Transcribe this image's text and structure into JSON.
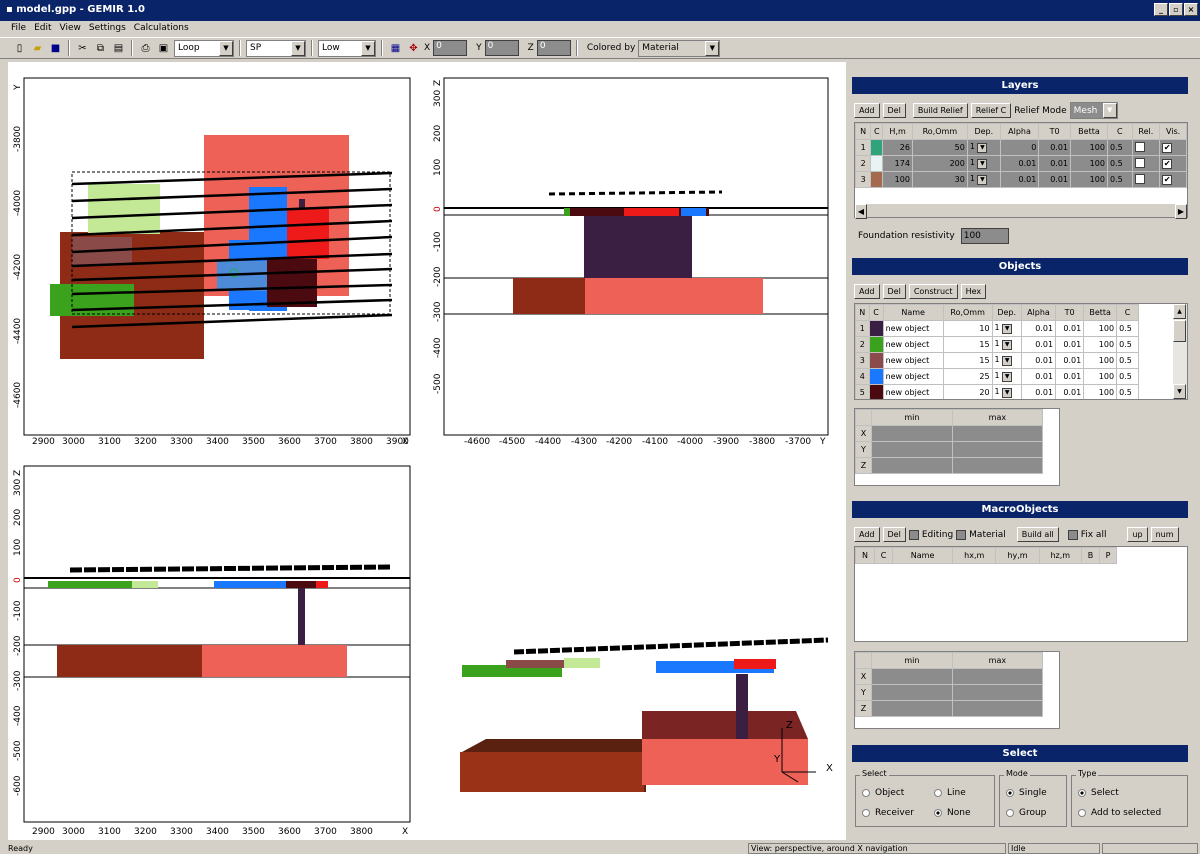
{
  "window": {
    "title": "model.gpp - GEMIR 1.0"
  },
  "menu": [
    "File",
    "Edit",
    "View",
    "Settings",
    "Calculations"
  ],
  "toolbar": {
    "mode": "Loop",
    "method": "SP",
    "quality": "Low",
    "x_label": "X",
    "x_value": "0",
    "y_label": "Y",
    "y_value": "0",
    "z_label": "Z",
    "z_value": "0",
    "colored_by_label": "Colored by",
    "colored_by": "Material"
  },
  "views": {
    "top": {
      "xticks": [
        "2900",
        "3000",
        "3100",
        "3200",
        "3300",
        "3400",
        "3500",
        "3600",
        "3700",
        "3800",
        "3900"
      ],
      "xaxis": "X",
      "yticks": [
        "-3800",
        "-4000",
        "-4200",
        "-4400",
        "-4600"
      ],
      "yaxis": "Y"
    },
    "side_y": {
      "xticks": [
        "-4600",
        "-4500",
        "-4400",
        "-4300",
        "-4200",
        "-4100",
        "-4000",
        "-3900",
        "-3800",
        "-3700"
      ],
      "xaxis": "Y",
      "yticks": [
        "300",
        "200",
        "100",
        "0",
        "-100",
        "-200",
        "-300",
        "-400",
        "-500"
      ],
      "yaxis": "Z"
    },
    "side_x": {
      "xticks": [
        "2900",
        "3000",
        "3100",
        "3200",
        "3300",
        "3400",
        "3500",
        "3600",
        "3700",
        "3800",
        "3900"
      ],
      "xaxis": "X",
      "yticks": [
        "300",
        "200",
        "100",
        "0",
        "-100",
        "-200",
        "-300",
        "-400",
        "-500",
        "-600"
      ],
      "yaxis": "Z"
    },
    "persp": {
      "x": "X",
      "y": "Y",
      "z": "Z"
    }
  },
  "layers": {
    "title": "Layers",
    "buttons": [
      "Add",
      "Del",
      "Build Relief",
      "Relief C"
    ],
    "relief_mode_label": "Relief Mode",
    "relief_mode": "Mesh",
    "headers": [
      "N",
      "C",
      "H,m",
      "Ro,Omm",
      "Dep.",
      "Alpha",
      "T0",
      "Betta",
      "C",
      "Rel.",
      "Vis."
    ],
    "rows": [
      {
        "n": "1",
        "color": "#2fa37a",
        "h": "26",
        "ro": "50",
        "dep": "1",
        "alpha": "0",
        "t0": "0.01",
        "betta": "100",
        "c": "0.5",
        "rel": "",
        "vis": "✔"
      },
      {
        "n": "2",
        "color": "#e8f4f4",
        "h": "174",
        "ro": "200",
        "dep": "1",
        "alpha": "0.01",
        "t0": "0.01",
        "betta": "100",
        "c": "0.5",
        "rel": "",
        "vis": "✔"
      },
      {
        "n": "3",
        "color": "#a46a50",
        "h": "100",
        "ro": "30",
        "dep": "1",
        "alpha": "0.01",
        "t0": "0.01",
        "betta": "100",
        "c": "0.5",
        "rel": "",
        "vis": "✔"
      }
    ],
    "foundation_label": "Foundation resistivity",
    "foundation_value": "100"
  },
  "objects": {
    "title": "Objects",
    "buttons": [
      "Add",
      "Del",
      "Construct",
      "Hex"
    ],
    "headers": [
      "N",
      "C",
      "Name",
      "Ro,Omm",
      "Dep.",
      "Alpha",
      "T0",
      "Betta",
      "C"
    ],
    "rows": [
      {
        "n": "1",
        "color": "#3a1f42",
        "name": "new object",
        "ro": "10",
        "dep": "1",
        "alpha": "0.01",
        "t0": "0.01",
        "betta": "100",
        "c": "0.5"
      },
      {
        "n": "2",
        "color": "#3aa21c",
        "name": "new object",
        "ro": "15",
        "dep": "1",
        "alpha": "0.01",
        "t0": "0.01",
        "betta": "100",
        "c": "0.5"
      },
      {
        "n": "3",
        "color": "#8c4a4a",
        "name": "new object",
        "ro": "15",
        "dep": "1",
        "alpha": "0.01",
        "t0": "0.01",
        "betta": "100",
        "c": "0.5"
      },
      {
        "n": "4",
        "color": "#1a78ff",
        "name": "new object",
        "ro": "25",
        "dep": "1",
        "alpha": "0.01",
        "t0": "0.01",
        "betta": "100",
        "c": "0.5"
      },
      {
        "n": "5",
        "color": "#4a0a10",
        "name": "new object",
        "ro": "20",
        "dep": "1",
        "alpha": "0.01",
        "t0": "0.01",
        "betta": "100",
        "c": "0.5"
      }
    ],
    "minmax_headers": [
      "min",
      "max"
    ],
    "axes": [
      "X",
      "Y",
      "Z"
    ]
  },
  "macro": {
    "title": "MacroObjects",
    "buttons": {
      "add": "Add",
      "del": "Del",
      "build": "Build all",
      "up": "up",
      "num": "num"
    },
    "checks": {
      "editing": "Editing",
      "material": "Material",
      "fixall": "Fix all"
    },
    "headers": [
      "N",
      "C",
      "Name",
      "hx,m",
      "hy,m",
      "hz,m",
      "B",
      "P"
    ],
    "minmax_headers": [
      "min",
      "max"
    ],
    "axes": [
      "X",
      "Y",
      "Z"
    ]
  },
  "select": {
    "title": "Select",
    "select_group": "Select",
    "mode_group": "Mode",
    "type_group": "Type",
    "object": "Object",
    "line": "Line",
    "receiver": "Receiver",
    "none": "None",
    "single": "Single",
    "group": "Group",
    "select_opt": "Select",
    "add_to_selected": "Add to selected"
  },
  "status": {
    "left": "Ready",
    "middle": "View: perspective, around X navigation",
    "right": "Idle"
  }
}
